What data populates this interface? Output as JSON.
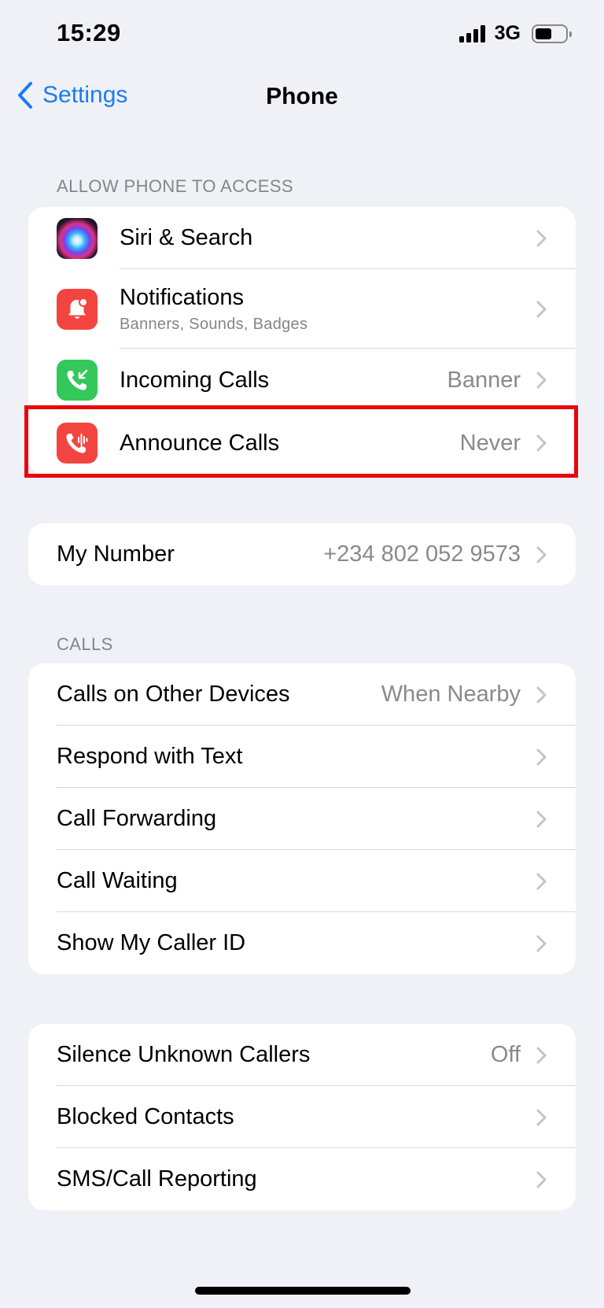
{
  "status_bar": {
    "time": "15:29",
    "network": "3G"
  },
  "nav": {
    "back_label": "Settings",
    "title": "Phone"
  },
  "access_section": {
    "header": "ALLOW PHONE TO ACCESS",
    "items": [
      {
        "label": "Siri & Search",
        "icon": "siri-icon"
      },
      {
        "label": "Notifications",
        "sublabel": "Banners, Sounds, Badges",
        "icon": "bell-icon"
      },
      {
        "label": "Incoming Calls",
        "value": "Banner",
        "icon": "incoming-call-icon"
      },
      {
        "label": "Announce Calls",
        "value": "Never",
        "icon": "announce-call-icon"
      }
    ]
  },
  "my_number": {
    "label": "My Number",
    "value": "+234 802 052 9573"
  },
  "calls_section": {
    "header": "CALLS",
    "items": [
      {
        "label": "Calls on Other Devices",
        "value": "When Nearby"
      },
      {
        "label": "Respond with Text"
      },
      {
        "label": "Call Forwarding"
      },
      {
        "label": "Call Waiting"
      },
      {
        "label": "Show My Caller ID"
      }
    ]
  },
  "blocking_section": {
    "items": [
      {
        "label": "Silence Unknown Callers",
        "value": "Off"
      },
      {
        "label": "Blocked Contacts"
      },
      {
        "label": "SMS/Call Reporting"
      }
    ]
  },
  "colors": {
    "accent": "#1a7cf5",
    "highlight": "#e8060d",
    "background": "#f0f1f6"
  }
}
